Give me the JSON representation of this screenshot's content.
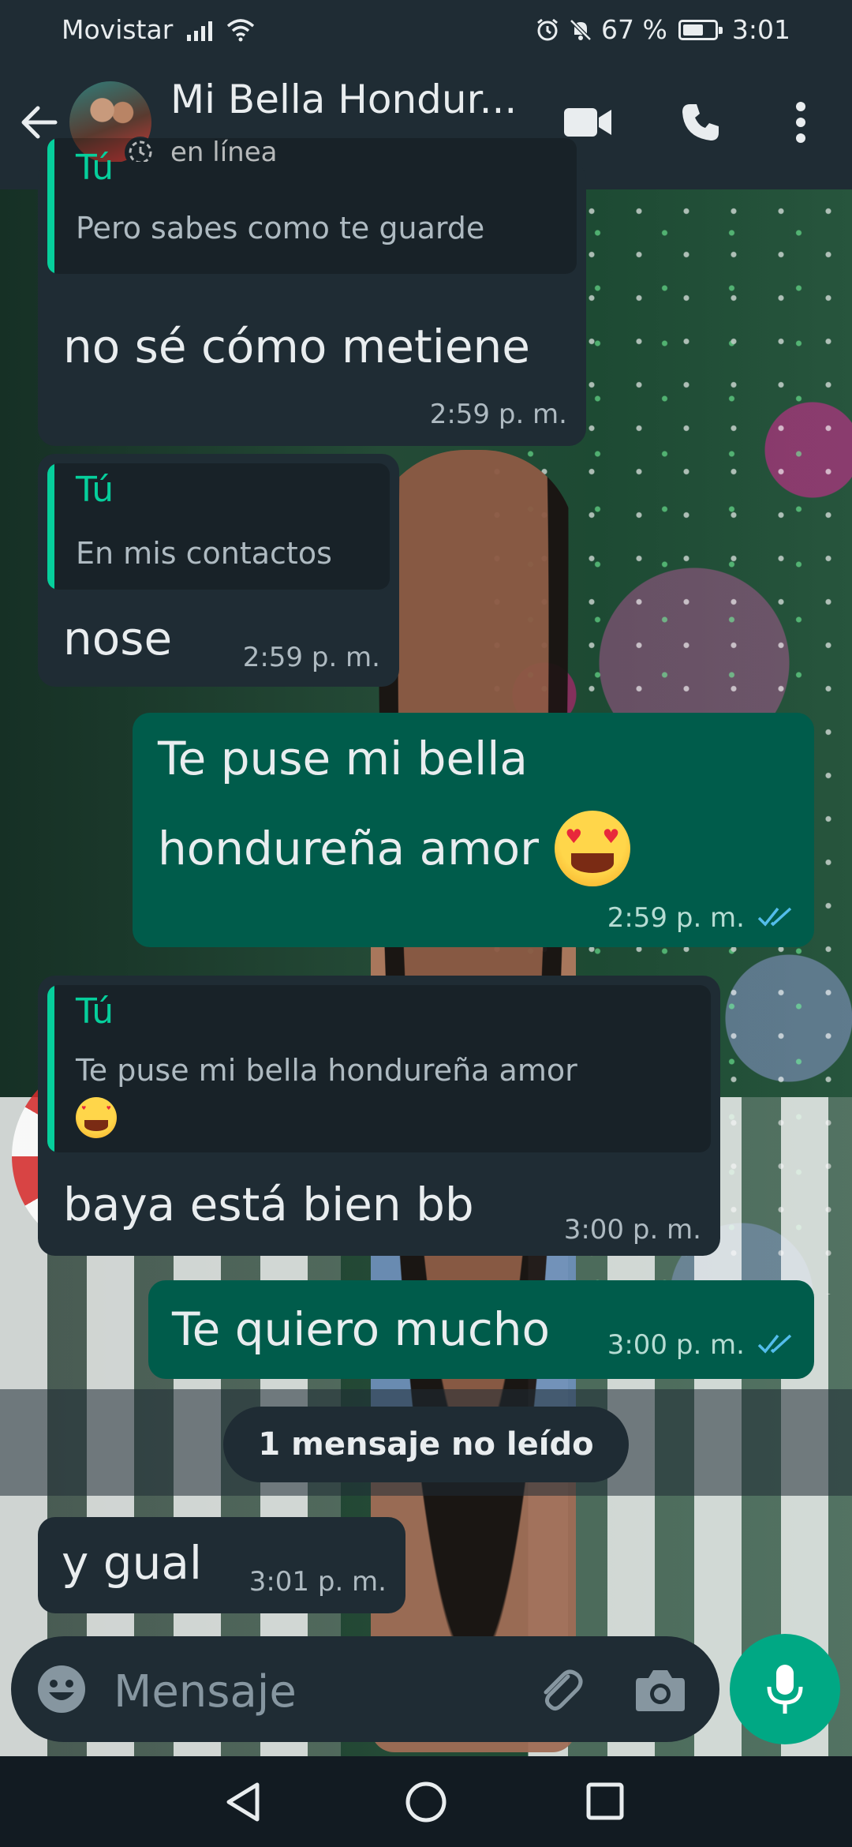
{
  "status_bar": {
    "carrier": "Movistar",
    "battery_percent": "67 %",
    "battery_level": 0.67,
    "time": "3:01"
  },
  "header": {
    "contact_name": "Mi Bella Hondur...",
    "contact_status": "en línea",
    "icons": [
      "back-arrow-icon",
      "video-call-icon",
      "phone-icon",
      "more-options-icon"
    ]
  },
  "messages": [
    {
      "direction": "in",
      "quote_author": "Tú",
      "quote_text": "Pero sabes como te guarde",
      "text": "no sé cómo metiene",
      "time": "2:59 p. m."
    },
    {
      "direction": "in",
      "quote_author": "Tú",
      "quote_text": "En mis contactos",
      "text": "nose",
      "time": "2:59 p. m."
    },
    {
      "direction": "out",
      "text_line1": "Te puse mi bella",
      "text_line2": "hondureña amor",
      "emoji": "heart-eyes-emoji",
      "time": "2:59 p. m.",
      "read": true
    },
    {
      "direction": "in",
      "quote_author": "Tú",
      "quote_text": "Te puse mi bella hondureña amor",
      "quote_emoji": "heart-eyes-emoji",
      "text": "baya está bien bb",
      "time": "3:00 p. m."
    },
    {
      "direction": "out",
      "text": "Te quiero mucho",
      "time": "3:00 p. m.",
      "read": true
    },
    {
      "direction": "in",
      "text": "y gual",
      "time": "3:01 p. m."
    }
  ],
  "unread_divider": "1 mensaje no leído",
  "composer": {
    "placeholder": "Mensaje",
    "icons": [
      "emoji-icon",
      "attach-icon",
      "camera-icon",
      "mic-icon"
    ]
  },
  "colors": {
    "header_bg": "#1f2c34",
    "incoming_bubble": "#1f2c34",
    "outgoing_bubble": "#005c4b",
    "accent": "#00a884",
    "quote_accent": "#06cf9c",
    "read_ticks": "#53bdeb"
  }
}
